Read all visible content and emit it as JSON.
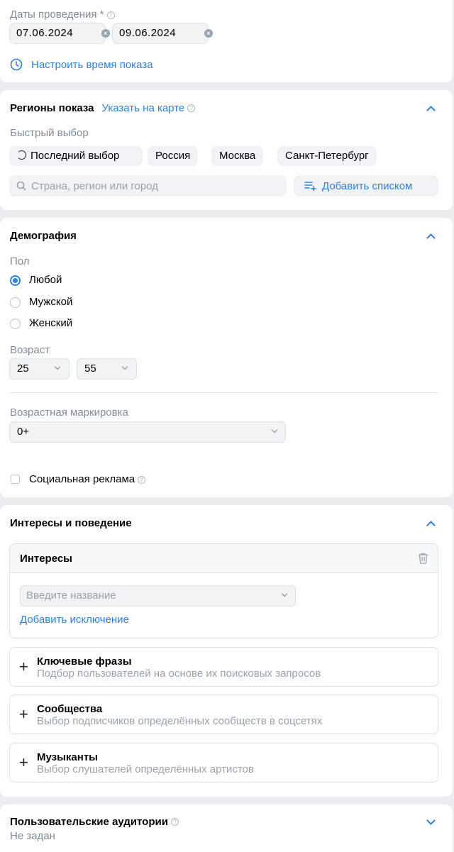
{
  "dates": {
    "label": "Даты проведения",
    "required_mark": "*",
    "start": "07.06.2024",
    "end": "09.06.2024",
    "time_link": "Настроить время показа"
  },
  "regions": {
    "title": "Регионы показа",
    "map_link": "Указать на карте",
    "quick_label": "Быстрый выбор",
    "chips": [
      "Последний выбор",
      "Россия",
      "Москва",
      "Санкт-Петербург"
    ],
    "search_placeholder": "Страна, регион или город",
    "add_list": "Добавить списком"
  },
  "demography": {
    "title": "Демография",
    "gender_label": "Пол",
    "genders": [
      "Любой",
      "Мужской",
      "Женский"
    ],
    "selected_gender": "Любой",
    "age_label": "Возраст",
    "age_from": "25",
    "age_to": "55",
    "age_marking_label": "Возрастная маркировка",
    "age_marking": "0+",
    "social_ad": "Социальная реклама"
  },
  "interests": {
    "title": "Интересы и поведение",
    "box_title": "Интересы",
    "input_placeholder": "Введите название",
    "exclusion_link": "Добавить исключение",
    "sections": [
      {
        "title": "Ключевые фразы",
        "subtitle": "Подбор пользователей на основе их поисковых запросов"
      },
      {
        "title": "Сообщества",
        "subtitle": "Выбор подписчиков определённых сообществ в соцсетях"
      },
      {
        "title": "Музыканты",
        "subtitle": "Выбор слушателей определённых артистов"
      }
    ]
  },
  "audiences": {
    "title": "Пользовательские аудитории",
    "value": "Не задан"
  },
  "colors": {
    "accent": "#2d81e0",
    "background": "#ebedf0",
    "muted": "#818c99"
  }
}
